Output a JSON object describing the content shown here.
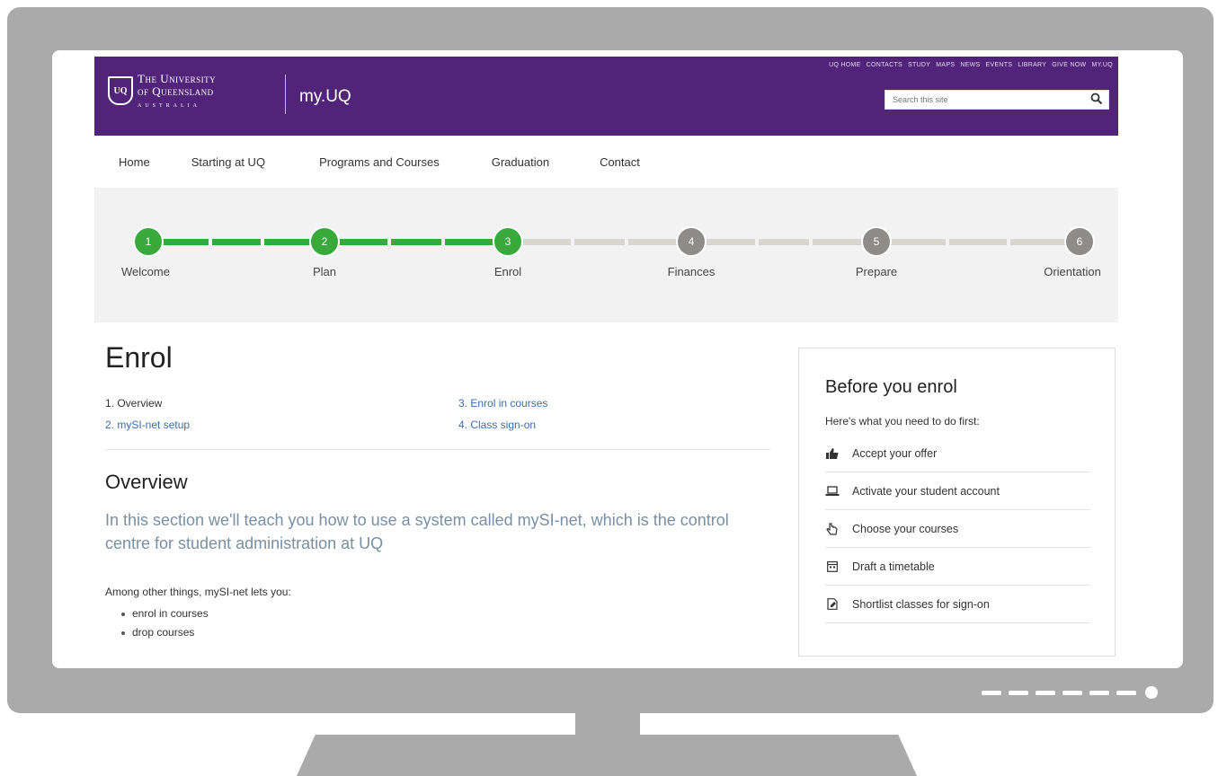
{
  "header": {
    "logo_line1": "The University",
    "logo_line2": "of Queensland",
    "logo_line3": "AUSTRALIA",
    "crest_text": "UQ",
    "site_name": "my.UQ",
    "utility_links": [
      "UQ HOME",
      "CONTACTS",
      "STUDY",
      "MAPS",
      "NEWS",
      "EVENTS",
      "LIBRARY",
      "GIVE NOW",
      "MY.UQ"
    ],
    "search_placeholder": "Search this site"
  },
  "nav": {
    "items": [
      "Home",
      "Starting at UQ",
      "Programs and Courses",
      "Graduation",
      "Contact"
    ]
  },
  "progress": {
    "steps": [
      {
        "number": "1",
        "label": "Welcome",
        "status": "complete"
      },
      {
        "number": "2",
        "label": "Plan",
        "status": "complete"
      },
      {
        "number": "3",
        "label": "Enrol",
        "status": "current"
      },
      {
        "number": "4",
        "label": "Finances",
        "status": "upcoming"
      },
      {
        "number": "5",
        "label": "Prepare",
        "status": "upcoming"
      },
      {
        "number": "6",
        "label": "Orientation",
        "status": "upcoming"
      }
    ],
    "colors": {
      "complete": "#39a93c",
      "upcoming": "#8e8b88",
      "track_done": "#39a93c",
      "track_todo": "#d9d6d2"
    }
  },
  "main": {
    "title": "Enrol",
    "toc": [
      {
        "label": "1. Overview",
        "active": true
      },
      {
        "label": "2. mySI-net setup",
        "active": false
      },
      {
        "label": "3. Enrol in courses",
        "active": false
      },
      {
        "label": "4. Class sign-on",
        "active": false
      }
    ],
    "overview_heading": "Overview",
    "lead": "In this section we'll teach you how to use a system called mySI-net, which is the control centre for student administration at UQ",
    "paragraph": "Among other things, mySI-net lets you:",
    "bullets": [
      "enrol in courses",
      "drop courses"
    ]
  },
  "aside": {
    "heading": "Before you enrol",
    "intro": "Here's what you need to do first:",
    "items": [
      {
        "label": "Accept your offer",
        "icon": "thumbs-up-icon"
      },
      {
        "label": "Activate your student account",
        "icon": "laptop-icon"
      },
      {
        "label": "Choose your courses",
        "icon": "pointer-hand-icon"
      },
      {
        "label": "Draft a timetable",
        "icon": "calendar-icon"
      },
      {
        "label": "Shortlist classes for sign-on",
        "icon": "edit-document-icon"
      }
    ]
  },
  "colors": {
    "brand_purple": "#51247a",
    "link_blue": "#3b6ea8",
    "monitor_grey": "#aaaaaa"
  }
}
